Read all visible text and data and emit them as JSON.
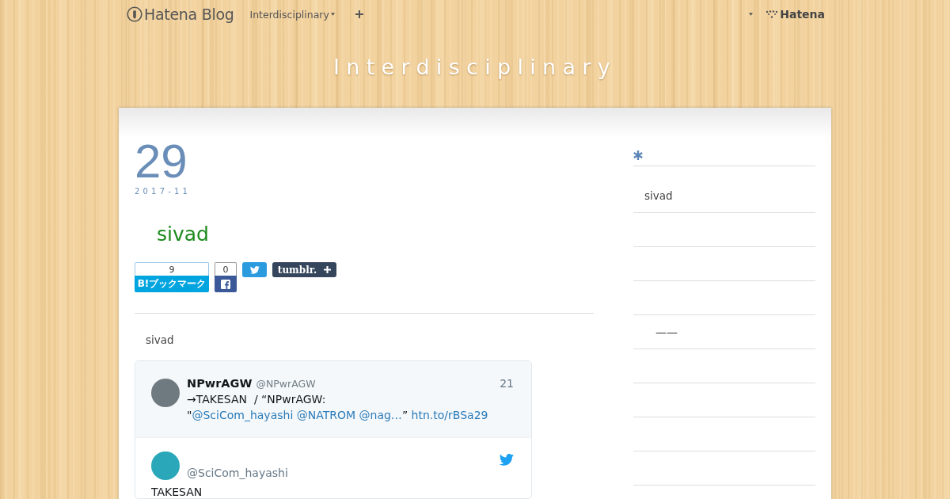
{
  "top_nav": {
    "logo": "Hatena Blog",
    "blog_menu": "Interdisciplinary",
    "brand": "Hatena"
  },
  "blog_title": "Interdisciplinary",
  "entry": {
    "day": "29",
    "year_month": "2017-11",
    "title": "sivad",
    "share": {
      "hatena_count": "9",
      "hatena_label": "B!ブックマーク",
      "facebook_count": "0",
      "tumblr_label": "tumblr."
    },
    "body": "sivad",
    "embed": {
      "quoted": {
        "name": "NPwrAGW",
        "handle": "@NPwrAGW",
        "time": "21",
        "lines": [
          [
            {
              "kind": "text",
              "text": "→TAKESAN  / “NPwrAGW:"
            }
          ],
          [
            {
              "kind": "text",
              "text": "\""
            },
            {
              "kind": "link",
              "text": "@SciCom_hayashi"
            },
            {
              "kind": "space"
            },
            {
              "kind": "link",
              "text": "@NATROM"
            },
            {
              "kind": "space"
            },
            {
              "kind": "link",
              "text": "@nag…"
            },
            {
              "kind": "text",
              "text": "”"
            },
            {
              "kind": "space"
            },
            {
              "kind": "link",
              "text": "htn.to/rBSa29"
            }
          ]
        ]
      },
      "tweet": {
        "handle": "@SciCom_hayashi",
        "text": "TAKESAN"
      }
    }
  },
  "sidebar": {
    "rows": [
      {
        "kind": "entry",
        "text": "sivad"
      },
      {
        "kind": "blank"
      },
      {
        "kind": "blank"
      },
      {
        "kind": "blank"
      },
      {
        "kind": "note",
        "text": "——"
      },
      {
        "kind": "blank"
      },
      {
        "kind": "blank"
      },
      {
        "kind": "blank"
      },
      {
        "kind": "blank"
      }
    ]
  }
}
